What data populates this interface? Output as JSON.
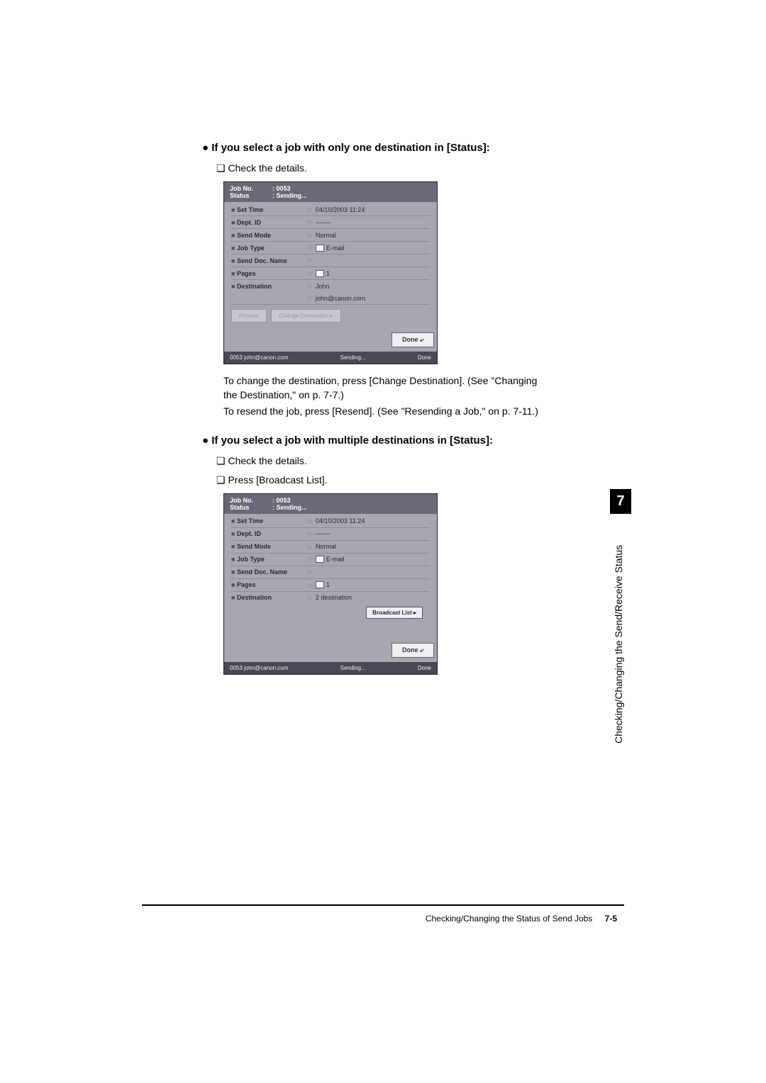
{
  "section1": {
    "heading": "If you select a job with only one destination in [Status]:",
    "check": "Check the details."
  },
  "shot": {
    "jobNoLabel": "Job No.",
    "jobNo": ": 0053",
    "statusLabel": "Status",
    "status": ": Sending...",
    "rows": {
      "setTimeL": "Set Time",
      "setTimeV": "04/10/2003 11:24",
      "deptL": "Dept. ID",
      "deptV": "-------",
      "sendModeL": "Send Mode",
      "sendModeV": "Normal",
      "jobTypeL": "Job Type",
      "jobTypeV": "E-mail",
      "docNameL": "Send Doc. Name",
      "docNameV": "",
      "pagesL": "Pages",
      "pagesV": "1",
      "destL": "Destination",
      "destV1_name": "John",
      "destV1_addr": "john@canon.com",
      "destV2": "2 destination"
    },
    "resend": "Resend",
    "changeDest": "Change Destination",
    "broadcast": "Broadcast List",
    "done": "Done",
    "footerL": "0053  john@canon.com",
    "footerM": "Sending...",
    "footerR": "Done"
  },
  "para1a": "To change the destination, press [Change Destination]. (See \"Changing the Destination,\" on p. 7-7.)",
  "para1b": "To resend the job, press [Resend]. (See \"Resending a Job,\" on p. 7-11.)",
  "section2": {
    "heading": "If you select a job with multiple destinations in [Status]:",
    "check1": "Check the details.",
    "check2": "Press [Broadcast List]."
  },
  "side": {
    "num": "7",
    "text": "Checking/Changing the Send/Receive Status"
  },
  "footer": {
    "text": "Checking/Changing the Status of Send Jobs",
    "page": "7-5"
  }
}
